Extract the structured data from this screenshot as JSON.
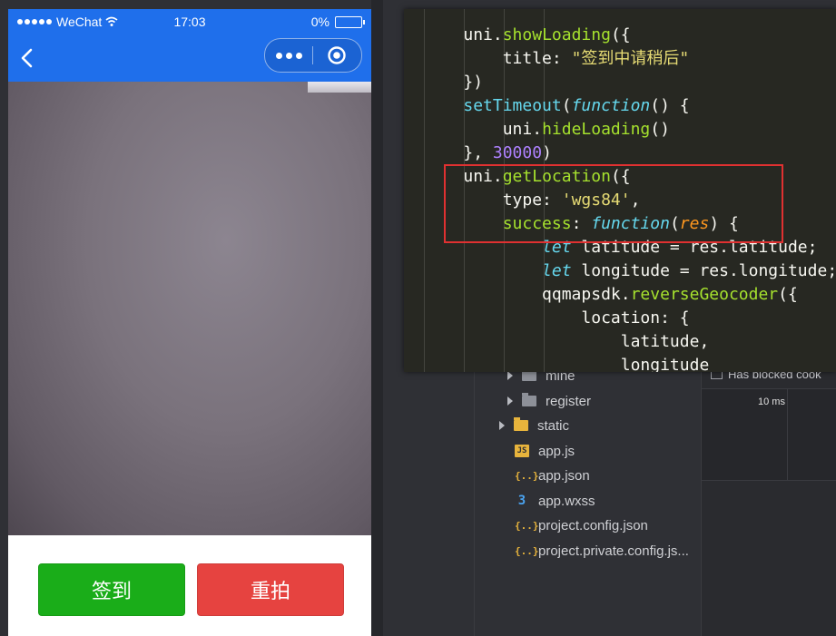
{
  "phone": {
    "status_bar": {
      "carrier": "WeChat",
      "time": "17:03",
      "battery": "0%"
    },
    "nav": {
      "back_icon": "chevron-left-icon",
      "more_icon": "more-dots-icon",
      "close_icon": "target-circle-icon"
    },
    "buttons": {
      "sign_in": "签到",
      "retake": "重拍"
    },
    "colors": {
      "nav_bg": "#1f6feb",
      "sign_in_bg": "#1aad19",
      "retake_bg": "#e64340"
    }
  },
  "code": {
    "lines": [
      {
        "indent": "    ",
        "tokens": [
          [
            "plain",
            "uni."
          ],
          [
            "fn",
            "showLoading"
          ],
          [
            "plain",
            "({"
          ]
        ]
      },
      {
        "indent": "        ",
        "tokens": [
          [
            "plain",
            "title: "
          ],
          [
            "str",
            "\"签到中请稍后\""
          ]
        ]
      },
      {
        "indent": "    ",
        "tokens": [
          [
            "plain",
            "})"
          ]
        ]
      },
      {
        "indent": "    ",
        "tokens": [
          [
            "blue",
            "setTimeout"
          ],
          [
            "plain",
            "("
          ],
          [
            "kw",
            "function"
          ],
          [
            "plain",
            "() {"
          ]
        ]
      },
      {
        "indent": "        ",
        "tokens": [
          [
            "plain",
            "uni."
          ],
          [
            "fn",
            "hideLoading"
          ],
          [
            "plain",
            "()"
          ]
        ]
      },
      {
        "indent": "    ",
        "tokens": [
          [
            "plain",
            "}, "
          ],
          [
            "num",
            "30000"
          ],
          [
            "plain",
            ")"
          ]
        ]
      },
      {
        "indent": "    ",
        "tokens": [
          [
            "plain",
            "uni."
          ],
          [
            "fn",
            "getLocation"
          ],
          [
            "plain",
            "({"
          ]
        ]
      },
      {
        "indent": "        ",
        "tokens": [
          [
            "plain",
            "type: "
          ],
          [
            "str",
            "'wgs84'"
          ],
          [
            "plain",
            ","
          ]
        ]
      },
      {
        "indent": "        ",
        "tokens": [
          [
            "fn",
            "success"
          ],
          [
            "plain",
            ": "
          ],
          [
            "kw",
            "function"
          ],
          [
            "plain",
            "("
          ],
          [
            "arg",
            "res"
          ],
          [
            "plain",
            ") {"
          ]
        ]
      },
      {
        "indent": "            ",
        "tokens": [
          [
            "kw",
            "let"
          ],
          [
            "plain",
            " latitude = res.latitude;"
          ]
        ]
      },
      {
        "indent": "            ",
        "tokens": [
          [
            "kw",
            "let"
          ],
          [
            "plain",
            " longitude = res.longitude;"
          ]
        ]
      },
      {
        "indent": "            ",
        "tokens": [
          [
            "plain",
            "qqmapsdk."
          ],
          [
            "fn",
            "reverseGeocoder"
          ],
          [
            "plain",
            "({"
          ]
        ]
      },
      {
        "indent": "                ",
        "tokens": [
          [
            "plain",
            "location: {"
          ]
        ]
      },
      {
        "indent": "                    ",
        "tokens": [
          [
            "plain",
            "latitude,"
          ]
        ]
      },
      {
        "indent": "                    ",
        "tokens": [
          [
            "plain",
            "longitude"
          ]
        ]
      }
    ]
  },
  "file_tree": {
    "items": [
      {
        "label": "mine",
        "icon": "folder-icon",
        "arrow": true
      },
      {
        "label": "register",
        "icon": "folder-icon",
        "arrow": true
      },
      {
        "label": "static",
        "icon": "folder-static-icon",
        "arrow": true
      },
      {
        "label": "app.js",
        "icon": "js-file-icon",
        "arrow": false
      },
      {
        "label": "app.json",
        "icon": "json-file-icon",
        "arrow": false
      },
      {
        "label": "app.wxss",
        "icon": "css-file-icon",
        "arrow": false
      },
      {
        "label": "project.config.json",
        "icon": "json-file-icon",
        "arrow": false
      },
      {
        "label": "project.private.config.js...",
        "icon": "json-file-icon",
        "arrow": false
      }
    ]
  },
  "network": {
    "blocked_label": "Has blocked cook",
    "tick_label": "10 ms"
  }
}
